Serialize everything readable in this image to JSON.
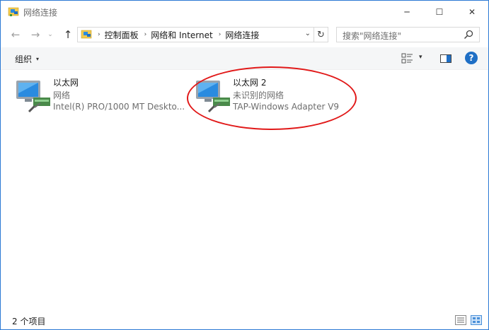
{
  "window": {
    "title": "网络连接",
    "controls": {
      "minimize": "─",
      "maximize": "☐",
      "close": "✕"
    }
  },
  "nav": {
    "back_glyph": "←",
    "forward_glyph": "→",
    "recent_glyph": "⌄",
    "up_glyph": "↑"
  },
  "address": {
    "breadcrumbs": [
      "控制面板",
      "网络和 Internet",
      "网络连接"
    ],
    "separator": "›",
    "dropdown_glyph": "⌄",
    "refresh_glyph": "↻"
  },
  "search": {
    "placeholder": "搜索\"网络连接\""
  },
  "toolbar": {
    "organize_label": "组织",
    "organize_arrow": "▾",
    "view_arrow": "▾",
    "help_label": "?"
  },
  "connections": [
    {
      "name": "以太网",
      "status": "网络",
      "adapter": "Intel(R) PRO/1000 MT Deskto..."
    },
    {
      "name": "以太网 2",
      "status": "未识别的网络",
      "adapter": "TAP-Windows Adapter V9"
    }
  ],
  "status_bar": {
    "item_count": "2 个项目"
  },
  "colors": {
    "accent": "#1f6fc5",
    "annotation": "#e11919",
    "monitor_blue": "#2a8be0"
  },
  "icons": [
    "network-folder-icon",
    "search-icon",
    "change-view-icon",
    "preview-pane-icon",
    "help-icon",
    "network-adapter-icon",
    "details-view-icon",
    "large-icons-view-icon"
  ]
}
